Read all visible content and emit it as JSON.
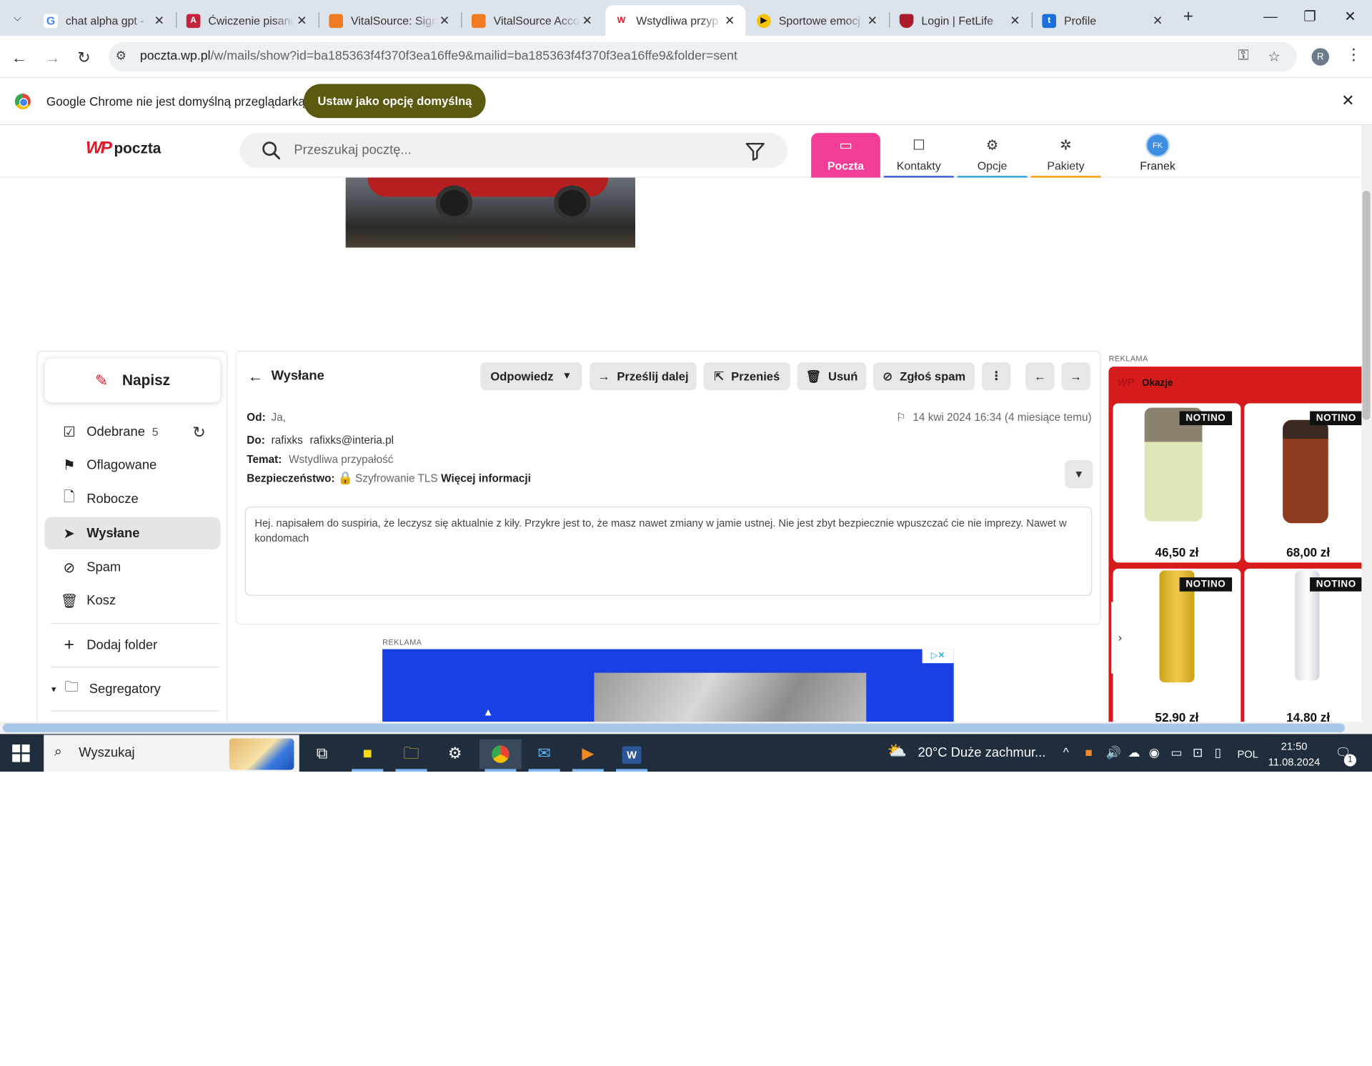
{
  "browser": {
    "tabs": [
      {
        "label": "chat alpha gpt -",
        "favicon": "google-icon",
        "color": "#4285f4"
      },
      {
        "label": "Ćwiczenie pisani",
        "favicon": "doc-icon",
        "color": "#c2223c"
      },
      {
        "label": "VitalSource: Sign",
        "favicon": "tag-icon",
        "color": "#f07b22"
      },
      {
        "label": "VitalSource Acco",
        "favicon": "tag-icon",
        "color": "#f07b22"
      },
      {
        "label": "Wstydliwa przyp",
        "favicon": "wp-icon",
        "color": "#e0192a"
      },
      {
        "label": "Sportowe emocj",
        "favicon": "play-icon",
        "color": "#f5c400"
      },
      {
        "label": "Login | FetLife",
        "favicon": "fetlife-icon",
        "color": "#a81c2c"
      },
      {
        "label": "Profile",
        "favicon": "tumblr-icon",
        "color": "#1a6fd8"
      }
    ],
    "url_domain": "poczta.wp.pl",
    "url_path": "/w/mails/show?id=ba185363f4f370f3ea16ffe9&mailid=ba185363f4f370f3ea16ffe9&folder=sent",
    "profile_initial": "R"
  },
  "infobar": {
    "text": "Google Chrome nie jest domyślną przeglądarką",
    "button": "Ustaw jako opcję domyślną"
  },
  "header": {
    "logo_mark": "WP",
    "logo_text": "poczta",
    "search_placeholder": "Przeszukaj pocztę...",
    "nav": [
      {
        "label": "Poczta",
        "icon": "inbox-icon",
        "color": "#f23e97"
      },
      {
        "label": "Kontakty",
        "icon": "contacts-icon",
        "color": "#3b5bdb"
      },
      {
        "label": "Opcje",
        "icon": "gear-icon",
        "color": "#2aa5d6"
      },
      {
        "label": "Pakiety",
        "icon": "packages-icon",
        "color": "#f59f00"
      }
    ],
    "user_initials": "FK",
    "user_name": "Franek"
  },
  "sidebar": {
    "compose": "Napisz",
    "folders": [
      {
        "label": "Odebrane",
        "count": "5",
        "icon": "inbox-check-icon"
      },
      {
        "label": "Oflagowane",
        "icon": "flag-icon"
      },
      {
        "label": "Robocze",
        "icon": "draft-icon"
      },
      {
        "label": "Wysłane",
        "icon": "send-icon",
        "active": true
      },
      {
        "label": "Spam",
        "icon": "spam-icon"
      },
      {
        "label": "Kosz",
        "icon": "trash-icon"
      }
    ],
    "add_folder": "Dodaj folder",
    "binders": "Segregatory"
  },
  "message": {
    "folder_title": "Wysłane",
    "actions": {
      "reply": "Odpowiedz",
      "forward": "Prześlij dalej",
      "move": "Przenieś",
      "delete": "Usuń",
      "spam": "Zgłoś spam"
    },
    "from_label": "Od:",
    "from_value": "Ja,",
    "to_label": "Do:",
    "to_name": "rafixks",
    "to_email": "rafixks@interia.pl",
    "subject_label": "Temat:",
    "subject_value": "Wstydliwa przypałość",
    "security_label": "Bezpieczeństwo:",
    "security_value": "Szyfrowanie TLS",
    "more_info": "Więcej informacji",
    "date": "14 kwi 2024 16:34 (4 miesiące temu)",
    "body": "Hej. napisałem do suspiria, że leczysz się aktualnie z kiły. Przykre jest to, że masz nawet zmiany w jamie ustnej. Nie jest zbyt bezpiecznie wpuszczać cie nie imprezy. Nawet w kondomach"
  },
  "ads": {
    "label": "REKLAMA",
    "okazje": "Okazje",
    "okazje_logo": "WP",
    "products": [
      {
        "badge": "NOTINO",
        "price": "46,50 zł"
      },
      {
        "badge": "NOTINO",
        "price": "68,00 zł"
      },
      {
        "badge": "NOTINO",
        "price": "52,90 zł"
      },
      {
        "badge": "NOTINO",
        "price": "14,80 zł"
      }
    ]
  },
  "taskbar": {
    "search": "Wyszukaj",
    "weather": "20°C  Duże zachmur...",
    "lang": "POL",
    "time": "21:50",
    "date": "11.08.2024",
    "notifications": "1"
  }
}
